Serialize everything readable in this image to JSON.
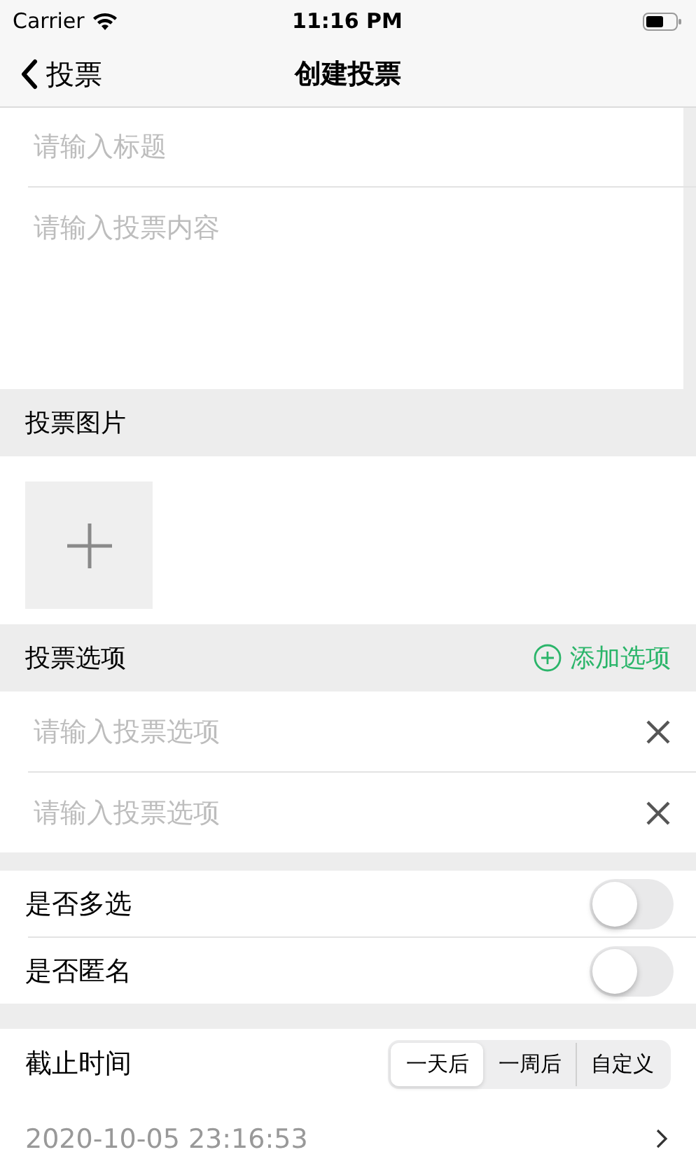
{
  "status_bar": {
    "carrier": "Carrier",
    "time": "11:16 PM"
  },
  "nav": {
    "back_label": "投票",
    "title": "创建投票"
  },
  "title_field": {
    "placeholder": "请输入标题"
  },
  "content_field": {
    "placeholder": "请输入投票内容"
  },
  "image_section": {
    "header": "投票图片"
  },
  "options_section": {
    "header": "投票选项",
    "add_label": "添加选项",
    "options": [
      {
        "placeholder": "请输入投票选项"
      },
      {
        "placeholder": "请输入投票选项"
      }
    ]
  },
  "toggles": [
    {
      "label": "是否多选",
      "on": false
    },
    {
      "label": "是否匿名",
      "on": false
    }
  ],
  "deadline": {
    "label": "截止时间",
    "segments": [
      {
        "label": "一天后",
        "selected": true
      },
      {
        "label": "一周后",
        "selected": false
      },
      {
        "label": "自定义",
        "selected": false
      }
    ],
    "value": "2020-10-05 23:16:53"
  }
}
